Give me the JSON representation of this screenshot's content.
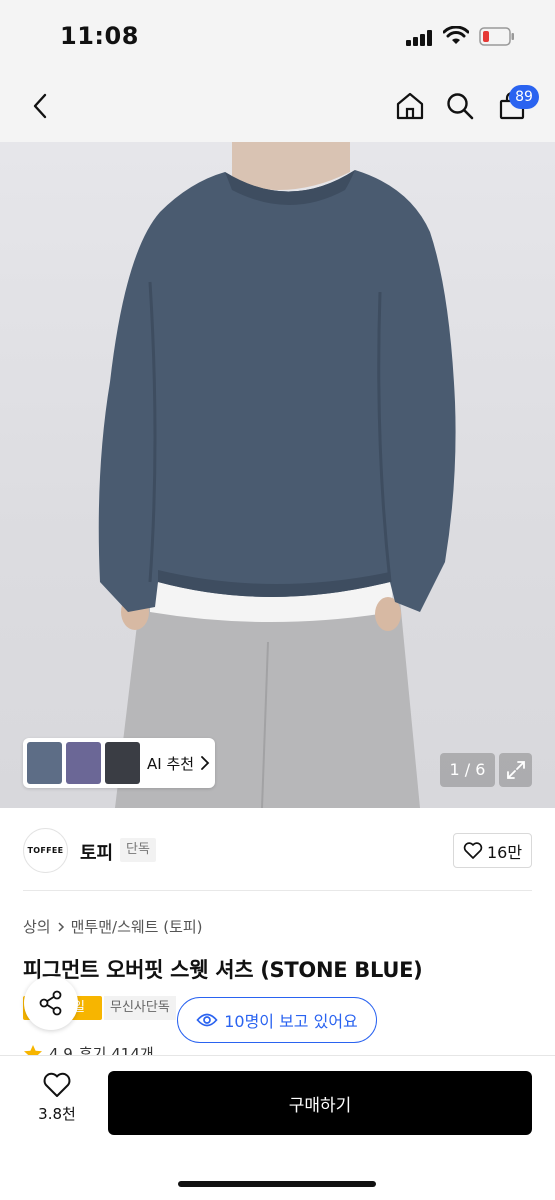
{
  "status_bar": {
    "time": "11:08"
  },
  "header": {
    "cart_count": "89"
  },
  "icons": {
    "back": "chevron-left-icon",
    "home": "home-icon",
    "search": "search-icon",
    "cart": "cart-icon",
    "share": "share-icon",
    "eye": "eye-icon",
    "heart": "heart-icon",
    "expand": "expand-icon",
    "star": "star-icon"
  },
  "gallery": {
    "ai_label": "AI 추천",
    "page_indicator": "1 / 6"
  },
  "brand": {
    "logo_text": "TOFFEE",
    "name": "토피",
    "tag": "단독",
    "likes": "16만"
  },
  "breadcrumb": {
    "category": "상의",
    "subcategory": "맨투맨/스웨트 (토피)"
  },
  "product": {
    "title": "피그먼트 오버핏 스웻 셔츠 (STONE BLUE)",
    "badge_sale": "일",
    "badge_exclusive": "무신사단독",
    "viewers": "10명이 보고 있어요",
    "rating": "4.9",
    "reviews": "후기 414개"
  },
  "bottom": {
    "wish_count": "3.8천",
    "buy_label": "구매하기"
  },
  "colors": {
    "accent_blue": "#2a63f0",
    "sale_yellow": "#f7b500",
    "sweatshirt": "#4a5b70",
    "pants": "#b7b7b9"
  }
}
